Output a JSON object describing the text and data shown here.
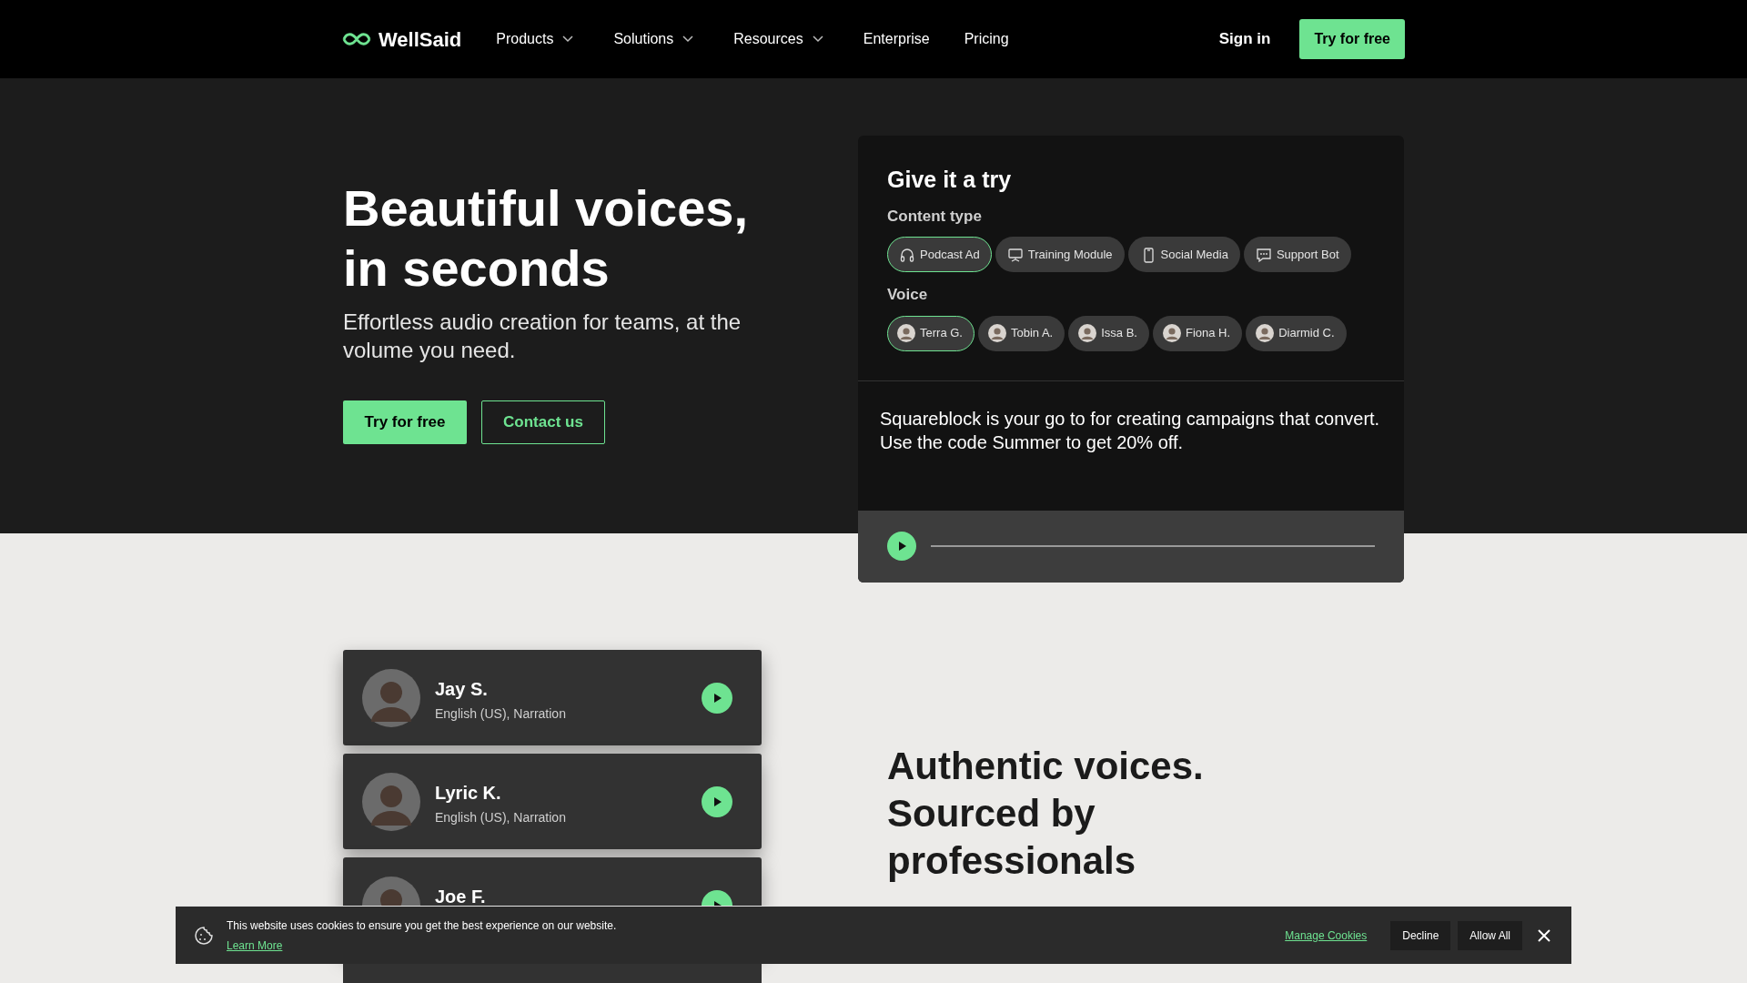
{
  "nav": {
    "brand": "WellSaid",
    "items": [
      {
        "label": "Products",
        "dropdown": true
      },
      {
        "label": "Solutions",
        "dropdown": true
      },
      {
        "label": "Resources",
        "dropdown": true
      },
      {
        "label": "Enterprise",
        "dropdown": false
      },
      {
        "label": "Pricing",
        "dropdown": false
      }
    ],
    "sign_in": "Sign in",
    "cta": "Try for free"
  },
  "hero": {
    "title_lines": [
      "Beautiful voices,",
      "in seconds"
    ],
    "subtitle": "Effortless audio creation for teams, at the volume you need.",
    "primary_button": "Try for free",
    "secondary_button": "Contact us"
  },
  "demo": {
    "title": "Give it a try",
    "content_label": "Content type",
    "content_types": [
      {
        "label": "Podcast Ad",
        "kind": "headphones",
        "selected": true
      },
      {
        "label": "Training Module",
        "kind": "easel",
        "selected": false
      },
      {
        "label": "Social Media",
        "kind": "phone",
        "selected": false
      },
      {
        "label": "Support Bot",
        "kind": "chat",
        "selected": false
      }
    ],
    "voice_label": "Voice",
    "voices": [
      {
        "label": "Terra G.",
        "selected": true
      },
      {
        "label": "Tobin A.",
        "selected": false
      },
      {
        "label": "Issa B.",
        "selected": false
      },
      {
        "label": "Fiona H.",
        "selected": false
      },
      {
        "label": "Diarmid C.",
        "selected": false
      }
    ],
    "script": "Squareblock is your go to for creating campaigns that convert. Use the code Summer to get 20% off."
  },
  "voice_cards": [
    {
      "name": "Jay S.",
      "details": "English (US), Narration"
    },
    {
      "name": "Lyric K.",
      "details": "English (US), Narration"
    },
    {
      "name": "Joe F."
    }
  ],
  "section_title_lines": [
    "Authentic voices.",
    "Sourced by",
    "professionals"
  ],
  "cookie_banner": {
    "message": "This website uses cookies to ensure you get the best experience on our website.",
    "learn_more": "Learn More",
    "manage": "Manage Cookies",
    "decline": "Decline",
    "allow": "Allow All"
  }
}
